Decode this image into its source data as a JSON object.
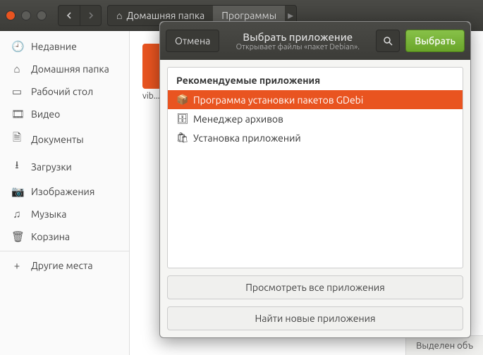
{
  "header": {
    "breadcrumbs": [
      {
        "label": "Домашняя папка",
        "icon": "home"
      },
      {
        "label": "Программы",
        "active": true
      }
    ]
  },
  "sidebar": {
    "items": [
      {
        "icon": "clock",
        "label": "Недавние"
      },
      {
        "icon": "home",
        "label": "Домашняя папка"
      },
      {
        "icon": "desktop",
        "label": "Рабочий стол"
      },
      {
        "icon": "video",
        "label": "Видео"
      },
      {
        "icon": "doc",
        "label": "Документы"
      },
      {
        "icon": "download",
        "label": "Загрузки"
      },
      {
        "icon": "camera",
        "label": "Изображения"
      },
      {
        "icon": "music",
        "label": "Музыка"
      },
      {
        "icon": "trash",
        "label": "Корзина"
      }
    ],
    "other": {
      "icon": "plus",
      "label": "Другие места"
    }
  },
  "content": {
    "file_label": "vib..."
  },
  "statusbar": {
    "text": "Выделен объ"
  },
  "dialog": {
    "cancel": "Отмена",
    "title": "Выбрать приложение",
    "subtitle": "Открывает файлы «пакет Debian».",
    "confirm": "Выбрать",
    "list_header": "Рекомендуемые приложения",
    "apps": [
      {
        "icon": "package",
        "label": "Программа установки пакетов GDebi",
        "selected": true
      },
      {
        "icon": "archive",
        "label": "Менеджер архивов",
        "selected": false
      },
      {
        "icon": "software",
        "label": "Установка приложений",
        "selected": false
      }
    ],
    "view_all": "Просмотреть все приложения",
    "find_new": "Найти новые приложения"
  }
}
